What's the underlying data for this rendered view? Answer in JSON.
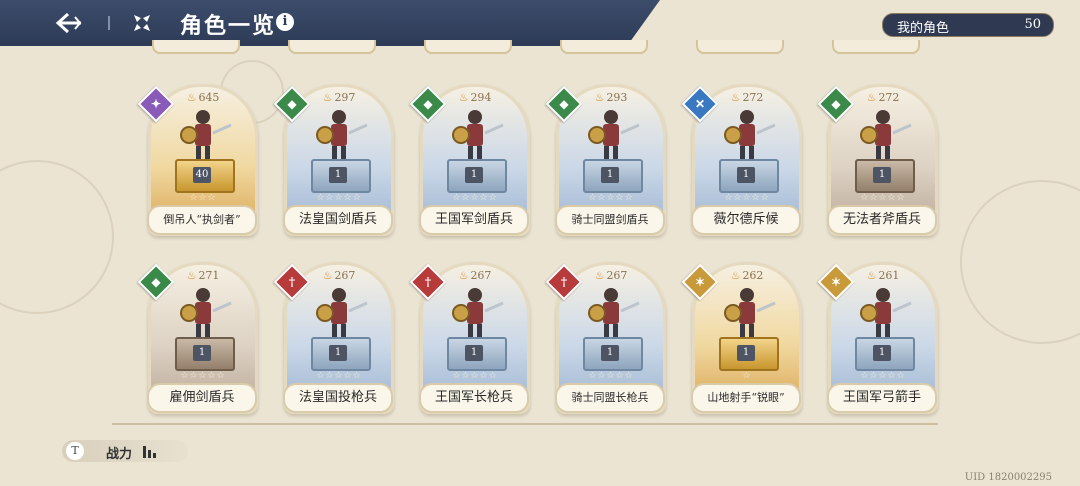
{
  "header": {
    "title": "角色一览",
    "info_icon": "i"
  },
  "my_characters": {
    "label": "我的角色",
    "count": "50"
  },
  "characters": [
    {
      "name": "倒吊人“执剑者”",
      "power": "645",
      "level": "40",
      "badge": "purple",
      "stars": "☆☆☆",
      "pedestal": "gold"
    },
    {
      "name": "法皇国剑盾兵",
      "power": "297",
      "level": "1",
      "badge": "shield",
      "stars": "☆☆☆☆☆",
      "pedestal": "blue"
    },
    {
      "name": "王国军剑盾兵",
      "power": "294",
      "level": "1",
      "badge": "shield",
      "stars": "☆☆☆☆☆",
      "pedestal": "blue"
    },
    {
      "name": "骑士同盟剑盾兵",
      "power": "293",
      "level": "1",
      "badge": "shield",
      "stars": "☆☆☆☆☆",
      "pedestal": "blue"
    },
    {
      "name": "薇尔德斥候",
      "power": "272",
      "level": "1",
      "badge": "blue",
      "stars": "☆☆☆☆☆",
      "pedestal": "blue"
    },
    {
      "name": "无法者斧盾兵",
      "power": "272",
      "level": "1",
      "badge": "shield",
      "stars": "☆☆☆☆☆",
      "pedestal": "brown"
    },
    {
      "name": "雇佣剑盾兵",
      "power": "271",
      "level": "1",
      "badge": "shield",
      "stars": "☆☆☆☆☆",
      "pedestal": "brown"
    },
    {
      "name": "法皇国投枪兵",
      "power": "267",
      "level": "1",
      "badge": "red",
      "stars": "☆☆☆☆☆",
      "pedestal": "blue"
    },
    {
      "name": "王国军长枪兵",
      "power": "267",
      "level": "1",
      "badge": "red",
      "stars": "☆☆☆☆☆",
      "pedestal": "blue"
    },
    {
      "name": "骑士同盟长枪兵",
      "power": "267",
      "level": "1",
      "badge": "red",
      "stars": "☆☆☆☆☆",
      "pedestal": "blue"
    },
    {
      "name": "山地射手“锐眼”",
      "power": "262",
      "level": "1",
      "badge": "gold",
      "stars": "☆",
      "pedestal": "gold"
    },
    {
      "name": "王国军弓箭手",
      "power": "261",
      "level": "1",
      "badge": "gold",
      "stars": "☆☆☆☆☆",
      "pedestal": "blue"
    }
  ],
  "footer": {
    "filter_key": "T",
    "filter_label": "战力",
    "uid": "UID 1820002295"
  },
  "colors": {
    "header_bg": "#2d3b56",
    "page_bg": "#ebe4d3",
    "shield_badge": "#3b8a4a",
    "spear_badge": "#b83b3b"
  }
}
